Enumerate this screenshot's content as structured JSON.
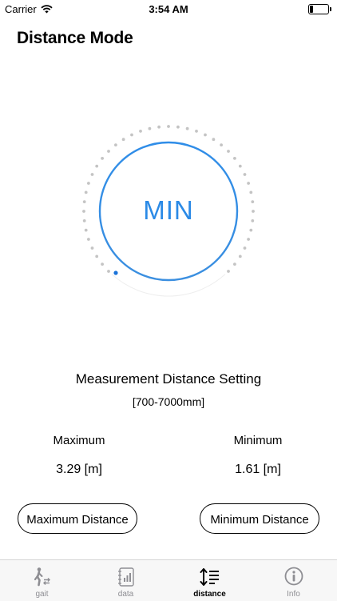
{
  "status_bar": {
    "carrier": "Carrier",
    "time": "3:54 AM"
  },
  "header": {
    "title": "Distance Mode"
  },
  "dial": {
    "label": "MIN",
    "accent_color": "#2b8ae6"
  },
  "setting": {
    "title": "Measurement Distance Setting",
    "range": "[700-7000mm]"
  },
  "maximum": {
    "label": "Maximum",
    "value": "3.29 [m]",
    "button": "Maximum Distance"
  },
  "minimum": {
    "label": "Minimum",
    "value": "1.61 [m]",
    "button": "Minimum Distance"
  },
  "tabs": [
    {
      "label": "gait",
      "icon": "walking-person-icon",
      "active": false
    },
    {
      "label": "data",
      "icon": "notebook-chart-icon",
      "active": false
    },
    {
      "label": "distance",
      "icon": "distance-arrows-icon",
      "active": true
    },
    {
      "label": "Info",
      "icon": "info-icon",
      "active": false
    }
  ]
}
